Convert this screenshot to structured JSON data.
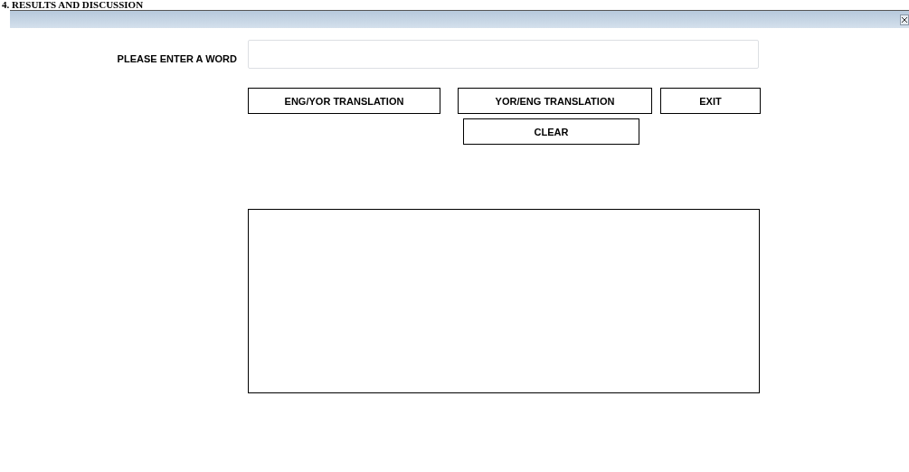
{
  "heading": "4.  RESULTS AND DISCUSSION",
  "word_field": {
    "label": "PLEASE ENTER A WORD"
  },
  "buttons": [
    {
      "label": "ENG/YOR TRANSLATION"
    },
    {
      "label": "YOR/ENG TRANSLATION"
    },
    {
      "label": "EXIT"
    },
    {
      "label": "CLEAR"
    }
  ]
}
